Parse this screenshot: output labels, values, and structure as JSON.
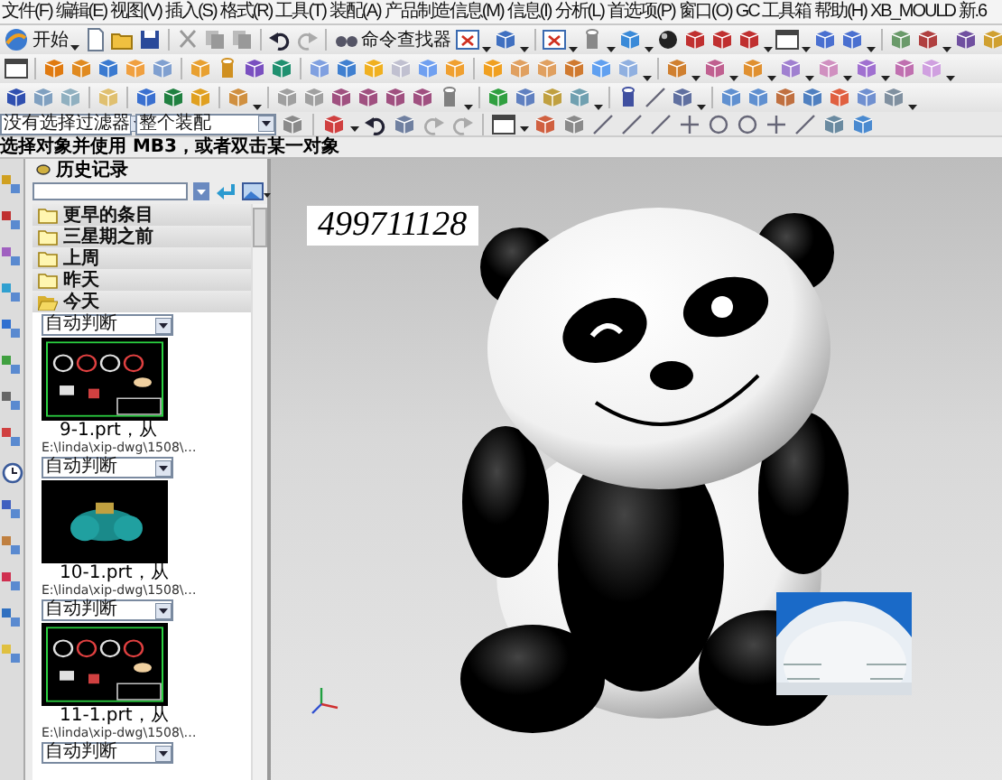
{
  "menu": [
    "文件(F)",
    "编辑(E)",
    "视图(V)",
    "插入(S)",
    "格式(R)",
    "工具(T)",
    "装配(A)",
    "产品制造信息(M)",
    "信息(I)",
    "分析(L)",
    "首选项(P)",
    "窗口(O)",
    "GC 工具箱",
    "帮助(H)",
    "XB_MOULD 新.6"
  ],
  "toolbar": {
    "start": "开始",
    "command_finder": "命令查找器"
  },
  "selection_bar": {
    "filter": "没有选择过滤器",
    "scope": "整个装配"
  },
  "status": "选择对象并使用 MB3，或者双击某一对象",
  "history_panel": {
    "title": "历史记录",
    "groups": [
      {
        "label": "更早的条目",
        "expanded": false
      },
      {
        "label": "三星期之前",
        "expanded": false
      },
      {
        "label": "上周",
        "expanded": false
      },
      {
        "label": "昨天",
        "expanded": false
      },
      {
        "label": "今天",
        "expanded": true
      }
    ],
    "items": [
      {
        "filter": "自动判断",
        "name": "9-1.prt，从",
        "path": "E:\\linda\\xip-dwg\\1508\\…"
      },
      {
        "filter": "自动判断",
        "name": "10-1.prt，从",
        "path": "E:\\linda\\xip-dwg\\1508\\…"
      },
      {
        "filter": "自动判断",
        "name": "11-1.prt，从",
        "path": "E:\\linda\\xip-dwg\\1508\\…"
      }
    ],
    "trailing_filter": "自动判断"
  },
  "viewport": {
    "label": "499711128"
  }
}
